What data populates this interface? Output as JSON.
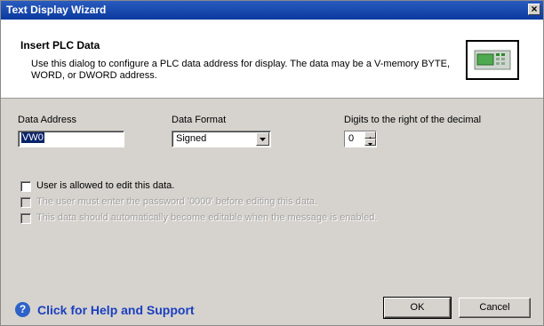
{
  "window": {
    "title": "Text Display Wizard",
    "close_label": "×"
  },
  "header": {
    "title": "Insert PLC Data",
    "description": "Use this dialog to configure a PLC data address for display. The data may be a V-memory BYTE, WORD, or DWORD address.",
    "icon": "plc-display-icon"
  },
  "fields": {
    "data_address_label": "Data Address",
    "data_address_value": "VW0",
    "data_format_label": "Data Format",
    "data_format_value": "Signed",
    "digits_label": "Digits to the right of the decimal",
    "digits_value": "0"
  },
  "checkboxes": {
    "editable": "User is allowed to edit this data.",
    "password": "The user must enter the password '0000' before editing this data.",
    "auto_editable": "This data should automatically become editable when the message is enabled."
  },
  "footer": {
    "help_text": "Click for Help and Support",
    "help_icon": "?",
    "ok_label": "OK",
    "cancel_label": "Cancel"
  },
  "colors": {
    "titlebar": "#0a3a9e",
    "dialog_bg": "#d6d3ce",
    "help_text": "#1a3fc0"
  }
}
